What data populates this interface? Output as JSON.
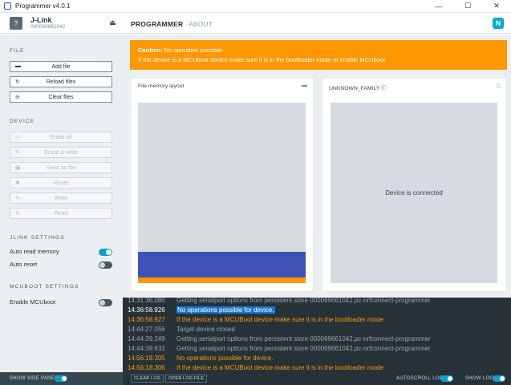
{
  "window": {
    "title": "Programmer v4.0.1",
    "minimize_glyph": "—",
    "maximize_glyph": "☐",
    "close_glyph": "✕"
  },
  "header": {
    "device_name": "J-Link",
    "device_serial": "000069661042",
    "chip_glyph": "?",
    "eject_glyph": "⏏",
    "tabs": [
      {
        "label": "PROGRAMMER",
        "active": true
      },
      {
        "label": "ABOUT",
        "active": false
      }
    ],
    "logo_glyph": "N"
  },
  "sidebar": {
    "file": {
      "title": "FILE",
      "buttons": [
        {
          "label": "Add file",
          "icon": "folder-open-icon",
          "glyph": "▬"
        },
        {
          "label": "Reload files",
          "icon": "reload-icon",
          "glyph": "↻"
        },
        {
          "label": "Clear files",
          "icon": "minus-circle-icon",
          "glyph": "⊖"
        }
      ]
    },
    "device": {
      "title": "DEVICE",
      "buttons": [
        {
          "label": "Erase all",
          "icon": "eraser-icon",
          "glyph": "◇"
        },
        {
          "label": "Erase & write",
          "icon": "pencil-icon",
          "glyph": "✎"
        },
        {
          "label": "Save as file",
          "icon": "save-icon",
          "glyph": "▣"
        },
        {
          "label": "Reset",
          "icon": "reset-icon",
          "glyph": "✱"
        },
        {
          "label": "Write",
          "icon": "pencil-icon",
          "glyph": "✎"
        },
        {
          "label": "Read",
          "icon": "refresh-icon",
          "glyph": "↻"
        }
      ]
    },
    "jlink": {
      "title": "JLINK SETTINGS",
      "auto_read_memory": {
        "label": "Auto read memory",
        "on": true
      },
      "auto_reset": {
        "label": "Auto reset",
        "on": false
      }
    },
    "mcuboot": {
      "title": "MCUBOOT SETTINGS",
      "enable_mcuboot": {
        "label": "Enable MCUboot",
        "on": false
      }
    }
  },
  "alert": {
    "bold": "Caution:",
    "line1": " No operation possible.",
    "line2": "If the device is a MCUboot device make sure it is in the bootloader mode or enable MCUboot."
  },
  "file_panel": {
    "title": "File memory layout",
    "icon_glyph": "▬"
  },
  "device_panel": {
    "title": "UNKNOWN_FAMILY",
    "info_glyph": "ⓘ",
    "phone_glyph": "▯",
    "status": "Device is connected"
  },
  "log": {
    "lines": [
      {
        "ts": "14:31:36.080",
        "msg": "Getting serialport options from persistent store 000069661042.pc-nrfconnect-programmer",
        "level": "grey"
      },
      {
        "ts": "14:36:58.926",
        "msg": "No operations possible for device.",
        "level": "white",
        "highlight": true
      },
      {
        "ts": "14:36:58.927",
        "msg": "If the device is a MCUBoot device make sure it is in the bootloader mode",
        "level": "orange"
      },
      {
        "ts": "14:44:27.056",
        "msg": "Target device closed",
        "level": "grey"
      },
      {
        "ts": "14:44:39.249",
        "msg": "Getting serialport options from persistent store 000069661042.pc-nrfconnect-programmer",
        "level": "grey"
      },
      {
        "ts": "14:44:39.632",
        "msg": "Getting serialport options from persistent store 000069661042.pc-nrfconnect-programmer",
        "level": "grey"
      },
      {
        "ts": "14:56:18.305",
        "msg": "No operations possible for device.",
        "level": "orange"
      },
      {
        "ts": "14:56:18.306",
        "msg": "If the device is a MCUBoot device make sure it is in the bootloader mode",
        "level": "orange"
      }
    ]
  },
  "footer": {
    "show_side_panel": "SHOW SIDE PANEL",
    "clear_log": "CLEAR LOG",
    "open_log_file": "OPEN LOG FILE",
    "autoscroll_log": "AUTOSCROLL LOG",
    "show_log": "SHOW LOG"
  },
  "colors": {
    "accent": "#0fa0c9",
    "warning": "#ff9800",
    "memory_block": "#3f51b5",
    "log_bg": "#263238"
  }
}
